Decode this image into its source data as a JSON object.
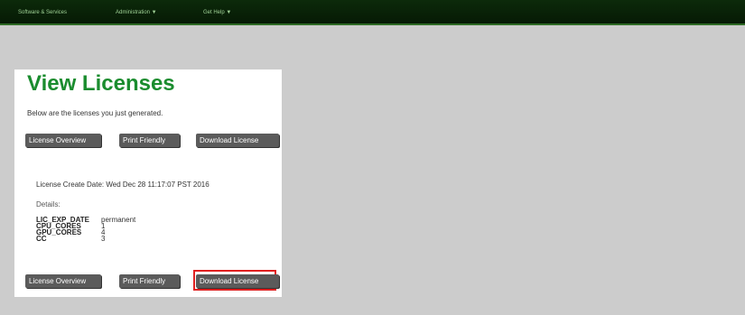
{
  "topnav": {
    "items": [
      "Software & Services",
      "Administration ▼",
      "Get Help ▼"
    ]
  },
  "page": {
    "title": "View Licenses",
    "intro": "Below are the licenses you just generated.",
    "buttons": {
      "overview": "License Overview",
      "print": "Print Friendly",
      "download": "Download License"
    },
    "create_date": "License Create Date: Wed Dec 28 11:17:07 PST 2016",
    "details_label": "Details:",
    "details": [
      {
        "key": "LIC_EXP_DATE",
        "value": "permanent"
      },
      {
        "key": "CPU_CORES",
        "value": "1"
      },
      {
        "key": "GPU_CORES",
        "value": "4"
      },
      {
        "key": "CC",
        "value": "3"
      }
    ]
  },
  "colors": {
    "title": "#1a8c2e",
    "topbar": "#0c2a0a",
    "button": "#5b5b5b",
    "highlight": "#e02020"
  }
}
